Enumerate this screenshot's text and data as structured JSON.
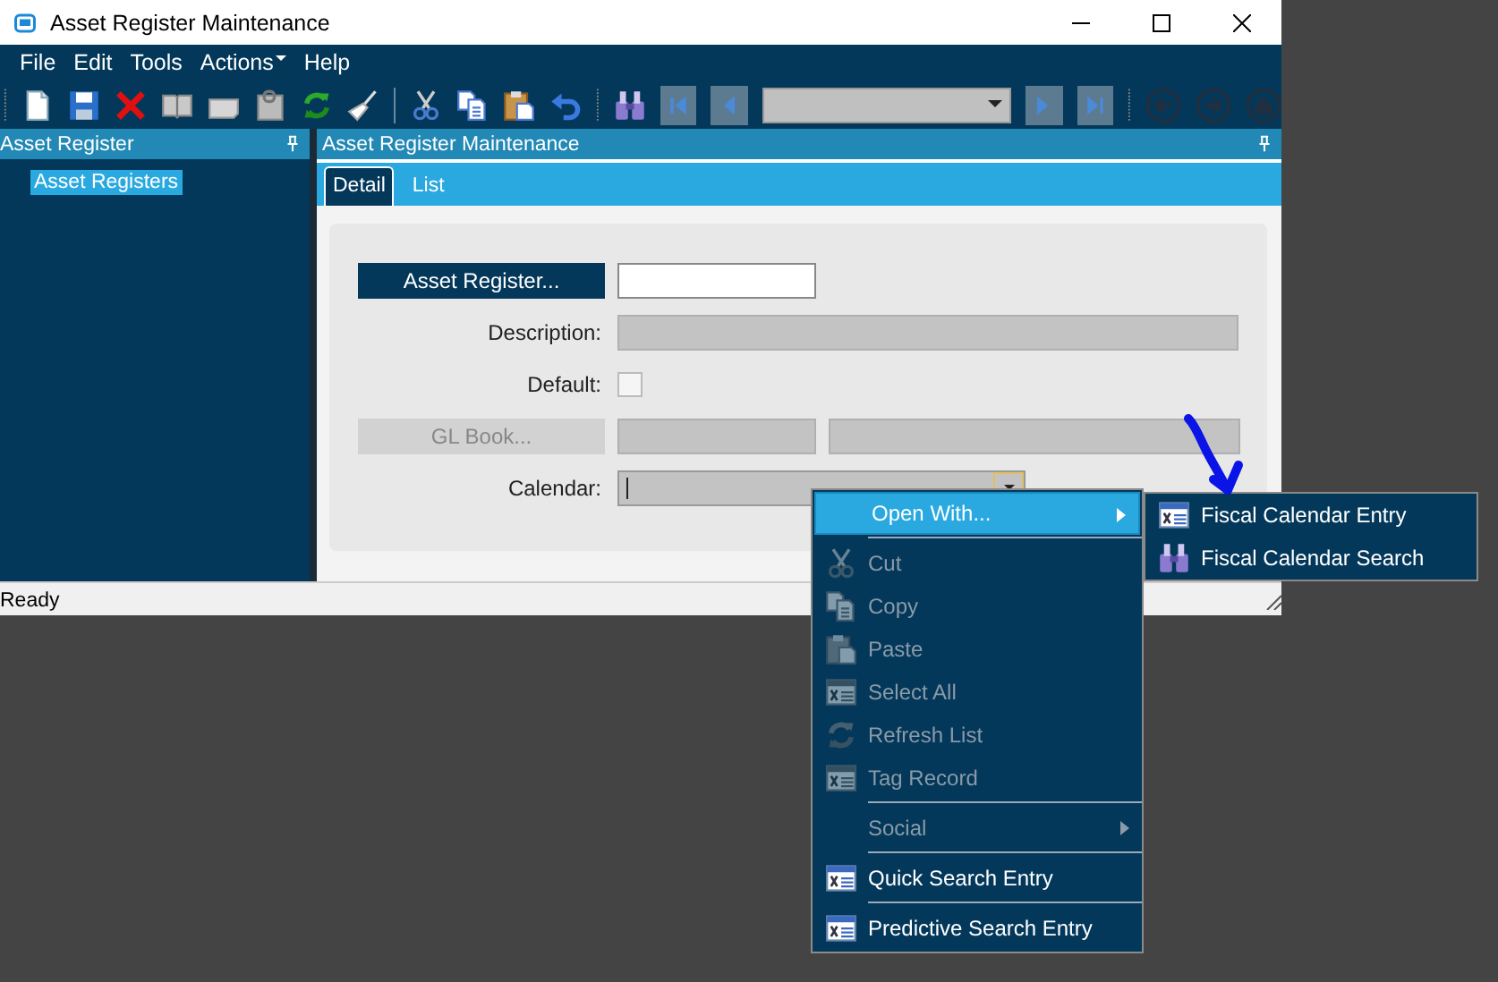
{
  "window": {
    "title": "Asset Register Maintenance"
  },
  "menu_bar": [
    {
      "label": "File",
      "has_submenu": false
    },
    {
      "label": "Edit",
      "has_submenu": false
    },
    {
      "label": "Tools",
      "has_submenu": false
    },
    {
      "label": "Actions",
      "has_submenu": true
    },
    {
      "label": "Help",
      "has_submenu": false
    }
  ],
  "toolbar": {
    "history_buttons": [
      {
        "disabled": true
      },
      {
        "disabled": true
      },
      {
        "disabled": true
      }
    ]
  },
  "left_panel": {
    "title": "Asset Register",
    "tree": [
      {
        "label": "Asset Registers",
        "selected": true
      }
    ]
  },
  "right_panel": {
    "title": "Asset Register Maintenance",
    "tabs": [
      {
        "label": "Detail",
        "selected": true
      },
      {
        "label": "List",
        "selected": false
      }
    ],
    "form": [
      {
        "kind": "lookup",
        "label": "Asset Register...",
        "disabled": false
      },
      {
        "kind": "text",
        "label": "Description:",
        "disabled": true
      },
      {
        "kind": "checkbox",
        "label": "Default:",
        "checked": false
      },
      {
        "kind": "lookup_pair",
        "label": "GL Book...",
        "disabled": true
      },
      {
        "kind": "combo",
        "label": "Calendar:",
        "disabled": true
      }
    ]
  },
  "status_bar": {
    "text": "Ready"
  },
  "context_menu": {
    "items": [
      {
        "kind": "item",
        "label": "Open With...",
        "selected": true,
        "disabled": false,
        "submenu": true
      },
      {
        "kind": "separator"
      },
      {
        "kind": "item",
        "label": "Cut",
        "selected": false,
        "disabled": true,
        "submenu": false
      },
      {
        "kind": "item",
        "label": "Copy",
        "selected": false,
        "disabled": true,
        "submenu": false
      },
      {
        "kind": "item",
        "label": "Paste",
        "selected": false,
        "disabled": true,
        "submenu": false
      },
      {
        "kind": "item",
        "label": "Select All",
        "selected": false,
        "disabled": true,
        "submenu": false
      },
      {
        "kind": "item",
        "label": "Refresh List",
        "selected": false,
        "disabled": true,
        "submenu": false
      },
      {
        "kind": "item",
        "label": "Tag Record",
        "selected": false,
        "disabled": true,
        "submenu": false
      },
      {
        "kind": "separator"
      },
      {
        "kind": "item",
        "label": "Social",
        "selected": false,
        "disabled": true,
        "submenu": true
      },
      {
        "kind": "separator"
      },
      {
        "kind": "item",
        "label": "Quick Search Entry",
        "selected": false,
        "disabled": false,
        "submenu": false
      },
      {
        "kind": "separator"
      },
      {
        "kind": "item",
        "label": "Predictive Search Entry",
        "selected": false,
        "disabled": false,
        "submenu": false
      }
    ],
    "submenu": [
      {
        "label": "Fiscal Calendar Entry"
      },
      {
        "label": "Fiscal Calendar Search"
      }
    ]
  }
}
